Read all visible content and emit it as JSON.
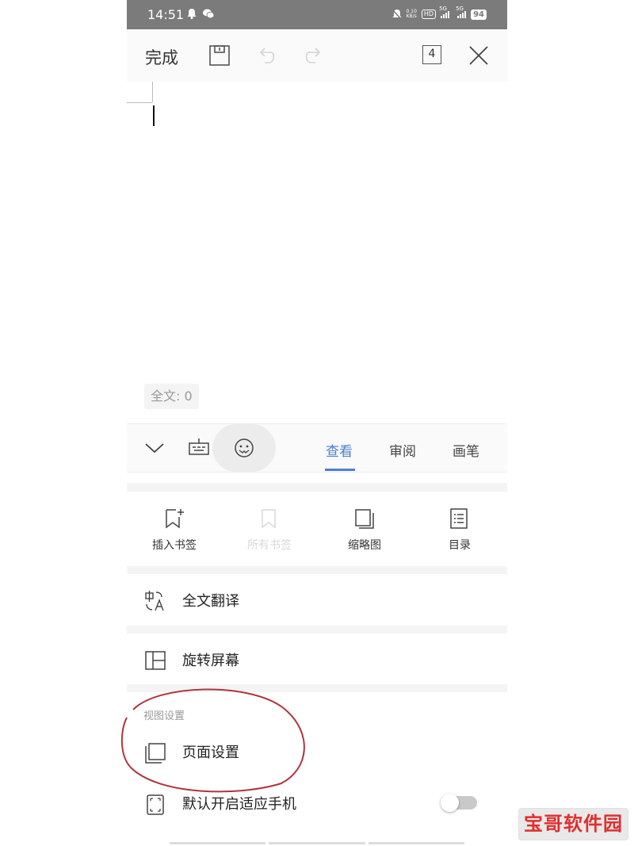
{
  "status_bar": {
    "time": "14:51",
    "speed_value": "0.10",
    "speed_unit": "KB/s",
    "hd_label": "HD",
    "sim1_label": "5G",
    "sim2_label": "5G",
    "battery": "94"
  },
  "toolbar": {
    "done_label": "完成",
    "page_count": "4"
  },
  "document": {
    "word_count": "全文: 0"
  },
  "tabs": [
    {
      "label": "查看",
      "active": true
    },
    {
      "label": "审阅",
      "active": false
    },
    {
      "label": "画笔",
      "active": false
    }
  ],
  "grid": [
    {
      "label": "插入书签",
      "icon": "bookmark-add-icon",
      "enabled": true
    },
    {
      "label": "所有书签",
      "icon": "bookmark-icon",
      "enabled": false
    },
    {
      "label": "缩略图",
      "icon": "thumbnail-icon",
      "enabled": true
    },
    {
      "label": "目录",
      "icon": "list-icon",
      "enabled": true
    }
  ],
  "menu": {
    "translate_label": "全文翻译",
    "rotate_label": "旋转屏幕",
    "view_section_title": "视图设置",
    "page_setup_label": "页面设置",
    "fit_phone_label": "默认开启适应手机",
    "fit_phone_on": false
  },
  "watermark": "宝哥软件园",
  "colors": {
    "accent": "#4b80d0",
    "annotation": "#b0343f",
    "watermark_text": "#e32d2d"
  }
}
